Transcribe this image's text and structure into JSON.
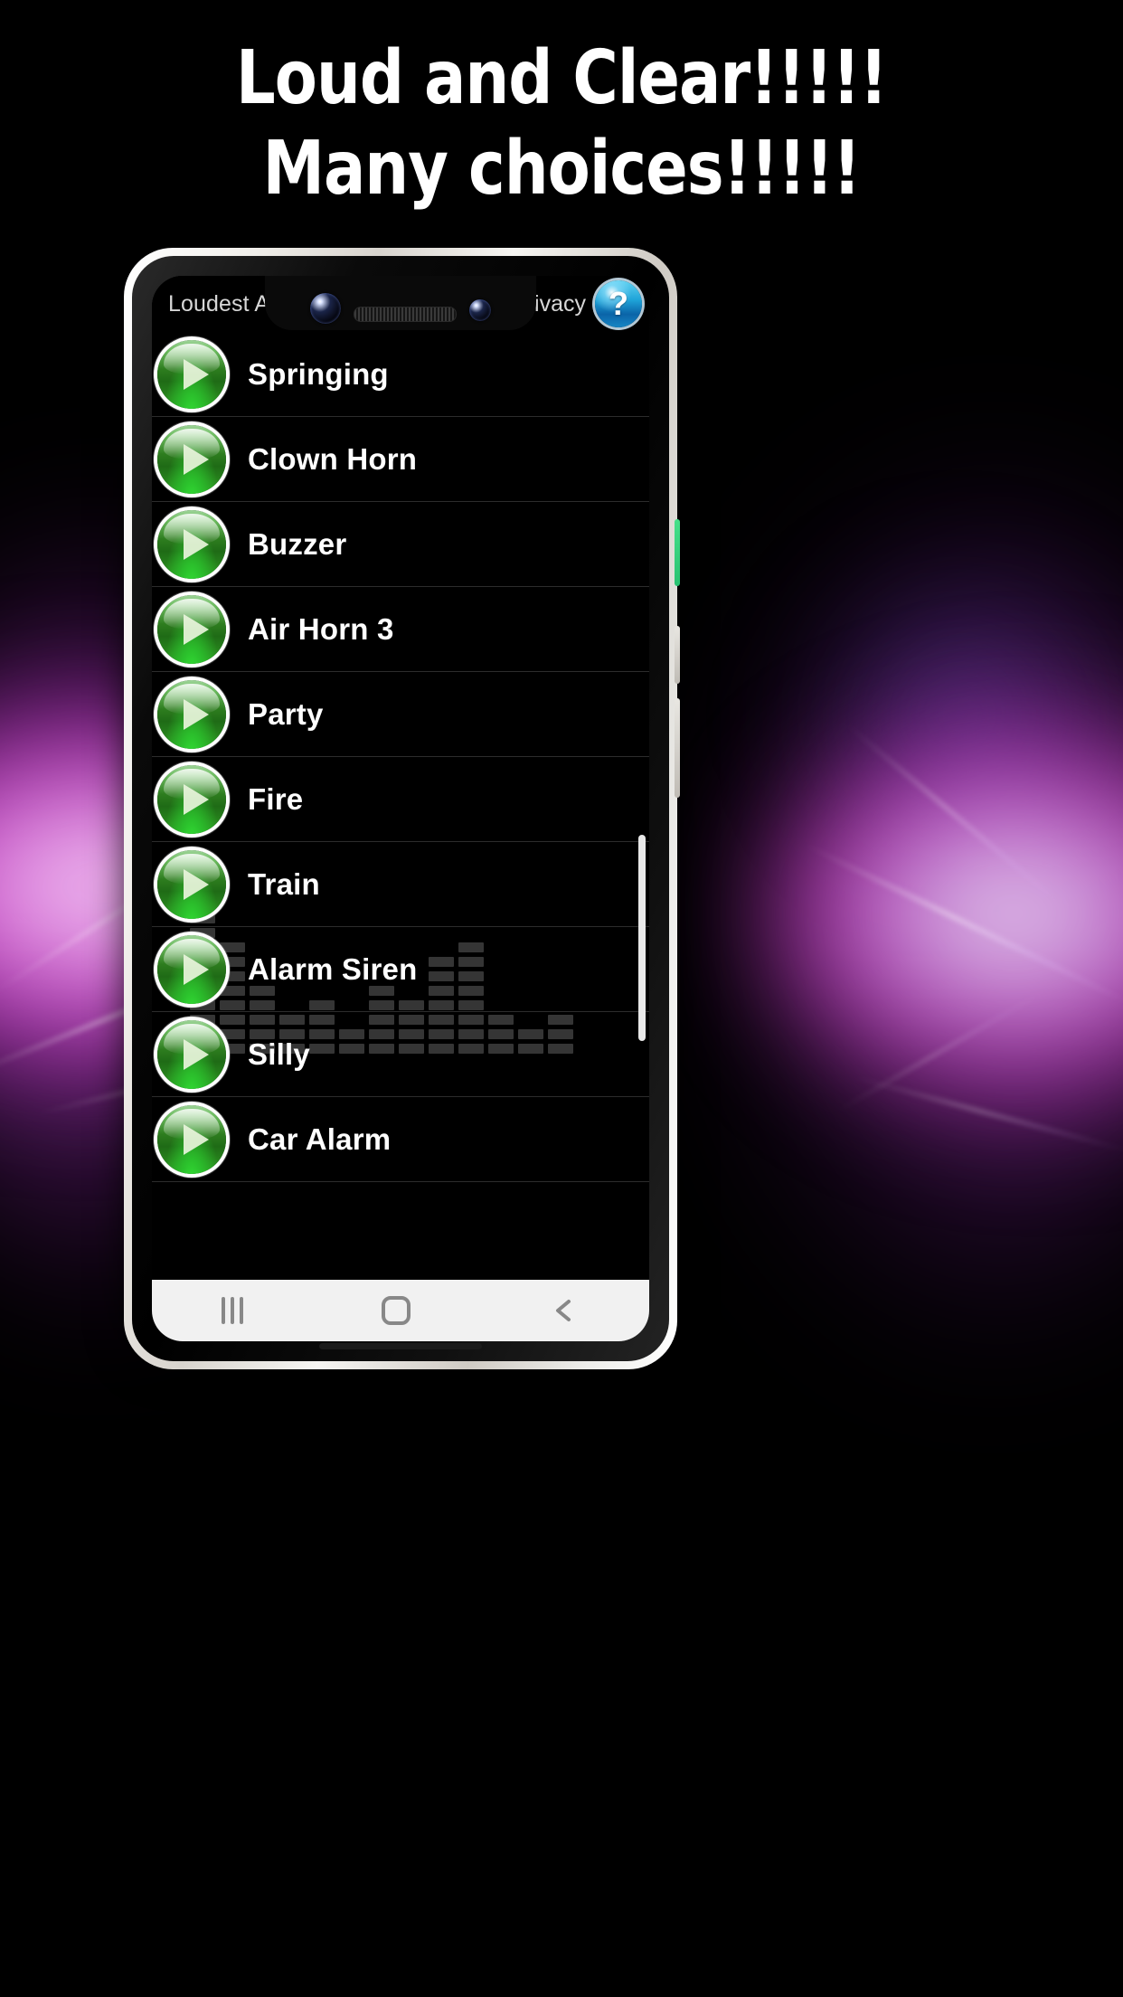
{
  "promo": {
    "headline_line1": "Loud and Clear!!!!!",
    "headline_line2": "Many choices!!!!!",
    "background_colors": {
      "base": "#000000",
      "glow_magenta": "#e23cdc",
      "glow_white": "#ffffff",
      "glow_purple": "#7a28a8"
    }
  },
  "device": {
    "frame_color": "#f2f0ec",
    "bezel_color": "#0a0a0a",
    "side_buttons": [
      {
        "name": "volume-accent",
        "color": "#2bc271"
      },
      {
        "name": "volume-up",
        "color": "#e9e7e2"
      },
      {
        "name": "power",
        "color": "#e9e7e2"
      }
    ],
    "notch": {
      "camera_front": "front-camera",
      "camera_secondary": "secondary-camera",
      "earpiece": "earpiece-speaker"
    }
  },
  "app": {
    "header": {
      "title": "Loudest Alarm R",
      "privacy_label": "Privacy",
      "help_glyph": "?",
      "help_color": "#1ea3d8"
    },
    "list": {
      "play_icon": "play-icon",
      "items": [
        {
          "label": "Springing"
        },
        {
          "label": "Clown Horn"
        },
        {
          "label": "Buzzer"
        },
        {
          "label": "Air Horn 3"
        },
        {
          "label": "Party"
        },
        {
          "label": "Fire"
        },
        {
          "label": "Train"
        },
        {
          "label": "Alarm Siren"
        },
        {
          "label": "Silly"
        },
        {
          "label": "Car Alarm"
        }
      ]
    },
    "equalizer": {
      "bar_color": "#3a3a3a",
      "columns": [
        10,
        8,
        5,
        3,
        4,
        2,
        5,
        4,
        7,
        8,
        3,
        2,
        3
      ]
    },
    "navbar": {
      "recents": "recents-icon",
      "home": "home-icon",
      "back": "back-icon"
    }
  }
}
